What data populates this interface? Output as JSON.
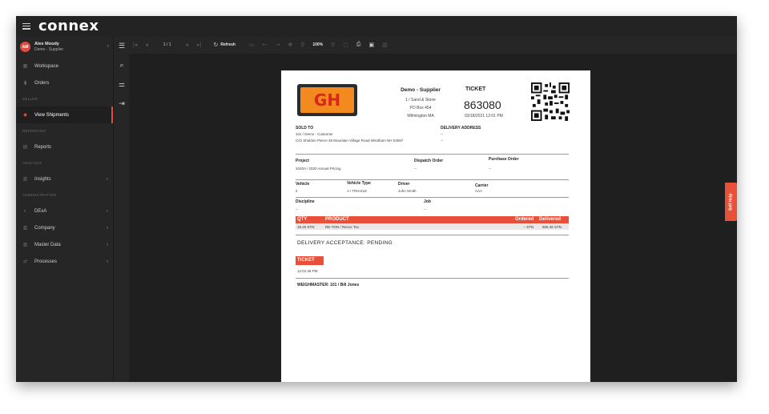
{
  "app": {
    "logo": "connex"
  },
  "user": {
    "initials": "AM",
    "name": "Alex Moody",
    "role": "Demo - Supplier"
  },
  "sidebar": {
    "workspace": "Workspace",
    "orders": "Orders",
    "section_seller": "SELLER",
    "view_shipments": "View Shipments",
    "section_reporting": "REPORTING",
    "reports": "Reports",
    "section_analysis": "ANALYSIS",
    "insights": "Insights",
    "section_admin": "ADMINISTRATION",
    "dexa": "DExA",
    "company": "Company",
    "master_data": "Master Data",
    "processes": "Processes"
  },
  "toolbar": {
    "page_indicator": "1 / 1",
    "refresh_label": "Refresh",
    "zoom": "100%"
  },
  "self_help": "Self Help",
  "ticket": {
    "supplier_name": "Demo - Supplier",
    "supplier_line1": "1 / Sand & Stone",
    "supplier_line2": "PO Box 454",
    "supplier_line3": "Wilmington MA",
    "ticket_label": "TICKET",
    "ticket_number": "863080",
    "ticket_date": "03/18/2021 12:01 PM",
    "sold_to_label": "SOLD TO",
    "sold_to_line1": "101 / Demo - Customer",
    "sold_to_line2": "C/O Sheldon Pierce 48 Mountain Village Road Windham NH 03087",
    "delivery_label": "DELIVERY ADDRESS",
    "delivery_line1": "--",
    "delivery_line2": "--",
    "project_label": "Project",
    "project_value": "2020A / 2020 Annual Pricing",
    "dispatch_label": "Dispatch Order",
    "dispatch_value": "--",
    "purchase_label": "Purchase Order",
    "purchase_value": "--",
    "vehicle_label": "Vehicle",
    "vehicle_value": "2",
    "vehicle_type_label": "Vehicle Type",
    "vehicle_type_value": "A / TRIAXLE",
    "driver_label": "Driver",
    "driver_value": "John Smith",
    "carrier_label": "Carrier",
    "carrier_value": "AAA",
    "discipline_label": "Discipline",
    "discipline_value": "--",
    "job_label": "Job",
    "job_value": "--",
    "col_qty": "QTY",
    "col_product": "PRODUCT",
    "col_ordered": "Ordered",
    "col_delivered": "Delivered",
    "row_qty": "19.20 STN",
    "row_product": "RE-TON / Recce Tox",
    "row_ordered": "-- STN",
    "row_delivered": "606.46 STN",
    "acceptance": "DELIVERY ACCEPTANCE: PENDING",
    "ticket_badge": "TICKET",
    "ticket_time": "12:01:46 PM",
    "weighmaster": "WEIGHMASTER: 101 / Bill Jones"
  },
  "colors": {
    "accent": "#e8503a",
    "sidebar_bg": "#262626",
    "viewer_bg": "#1f1f1f",
    "logo_orange": "#f28a1e",
    "logo_red": "#d9271f"
  },
  "icons": [
    "hamburger-icon",
    "avatar",
    "chevron-icon",
    "workspace-icon",
    "orders-icon",
    "shipments-icon",
    "reports-icon",
    "insights-icon",
    "dexa-icon",
    "company-icon",
    "master-data-icon",
    "processes-icon",
    "search-icon",
    "filter-icon",
    "export-icon",
    "sidebar-toggle-icon",
    "first-page-icon",
    "previous-page-icon",
    "next-page-icon",
    "last-page-icon",
    "refresh-icon",
    "zoom-in-icon",
    "zoom-out-icon",
    "print-icon",
    "qr-code"
  ]
}
